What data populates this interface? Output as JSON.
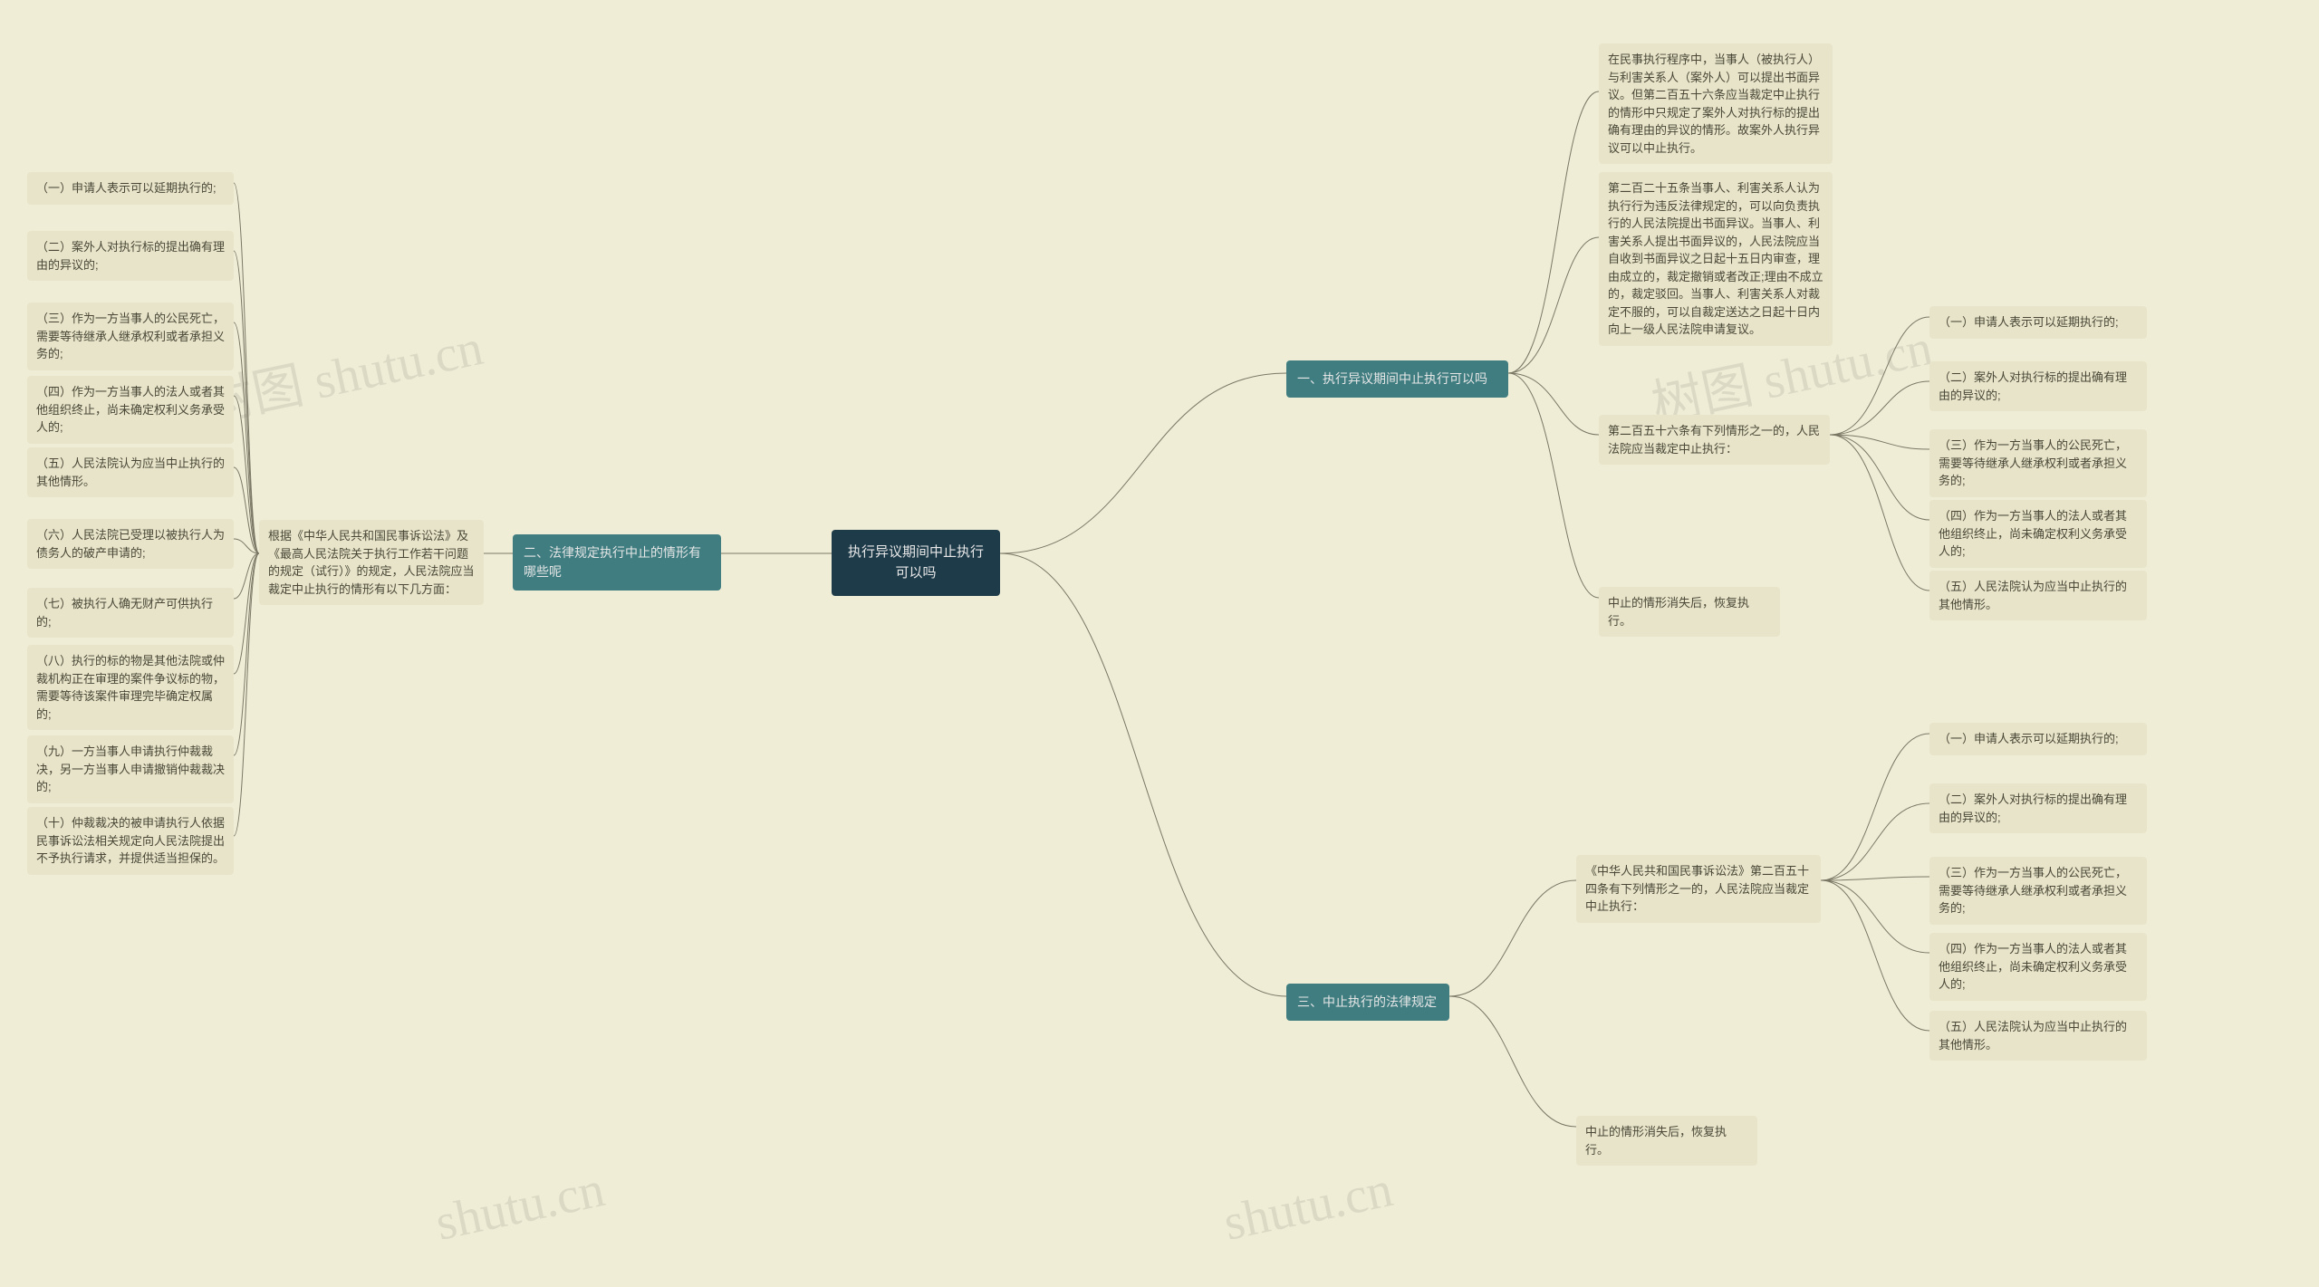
{
  "watermarks": [
    "树图 shutu.cn",
    "树图 shutu.cn",
    "shutu.cn",
    "shutu.cn"
  ],
  "root": {
    "title": "执行异议期间中止执行可以吗"
  },
  "branch1": {
    "title": "一、执行异议期间中止执行可以吗",
    "children": {
      "c1": "在民事执行程序中，当事人（被执行人）与利害关系人（案外人）可以提出书面异议。但第二百五十六条应当裁定中止执行的情形中只规定了案外人对执行标的提出确有理由的异议的情形。故案外人执行异议可以中止执行。",
      "c2": "第二百二十五条当事人、利害关系人认为执行行为违反法律规定的，可以向负责执行的人民法院提出书面异议。当事人、利害关系人提出书面异议的，人民法院应当自收到书面异议之日起十五日内审查，理由成立的，裁定撤销或者改正;理由不成立的，裁定驳回。当事人、利害关系人对裁定不服的，可以自裁定送达之日起十日内向上一级人民法院申请复议。",
      "c3": {
        "text": "第二百五十六条有下列情形之一的，人民法院应当裁定中止执行：",
        "items": [
          "（一）申请人表示可以延期执行的;",
          "（二）案外人对执行标的提出确有理由的异议的;",
          "（三）作为一方当事人的公民死亡，需要等待继承人继承权利或者承担义务的;",
          "（四）作为一方当事人的法人或者其他组织终止，尚未确定权利义务承受人的;",
          "（五）人民法院认为应当中止执行的其他情形。"
        ]
      },
      "c4": "中止的情形消失后，恢复执行。"
    }
  },
  "branch2": {
    "title": "二、法律规定执行中止的情形有哪些呢",
    "sub": {
      "text": "根据《中华人民共和国民事诉讼法》及《最高人民法院关于执行工作若干问题的规定（试行）》的规定，人民法院应当裁定中止执行的情形有以下几方面：",
      "items": [
        "（一）申请人表示可以延期执行的;",
        "（二）案外人对执行标的提出确有理由的异议的;",
        "（三）作为一方当事人的公民死亡，需要等待继承人继承权利或者承担义务的;",
        "（四）作为一方当事人的法人或者其他组织终止，尚未确定权利义务承受人的;",
        "（五）人民法院认为应当中止执行的其他情形。",
        "（六）人民法院已受理以被执行人为债务人的破产申请的;",
        "（七）被执行人确无财产可供执行的;",
        "（八）执行的标的物是其他法院或仲裁机构正在审理的案件争议标的物，需要等待该案件审理完毕确定权属的;",
        "（九）一方当事人申请执行仲裁裁决，另一方当事人申请撤销仲裁裁决的;",
        "（十）仲裁裁决的被申请执行人依据民事诉讼法相关规定向人民法院提出不予执行请求，并提供适当担保的。"
      ]
    }
  },
  "branch3": {
    "title": "三、中止执行的法律规定",
    "sub": {
      "text": "《中华人民共和国民事诉讼法》第二百五十四条有下列情形之一的，人民法院应当裁定中止执行：",
      "items": [
        "（一）申请人表示可以延期执行的;",
        "（二）案外人对执行标的提出确有理由的异议的;",
        "（三）作为一方当事人的公民死亡，需要等待继承人继承权利或者承担义务的;",
        "（四）作为一方当事人的法人或者其他组织终止，尚未确定权利义务承受人的;",
        "（五）人民法院认为应当中止执行的其他情形。"
      ]
    },
    "c2": "中止的情形消失后，恢复执行。"
  }
}
